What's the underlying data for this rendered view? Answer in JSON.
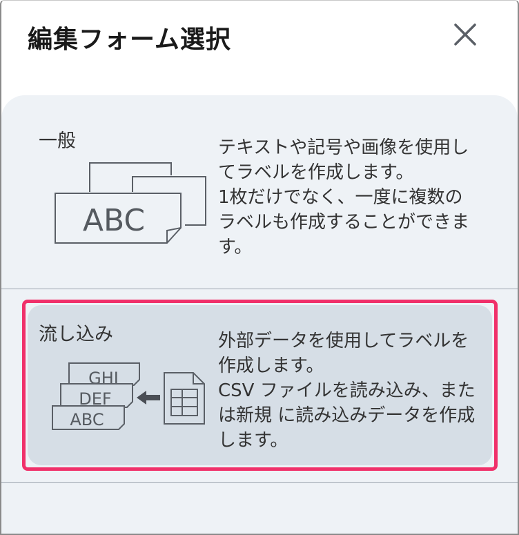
{
  "dialog": {
    "title": "編集フォーム選択"
  },
  "options": [
    {
      "label": "一般",
      "illustration_text": "ABC",
      "description": "テキストや記号や画像を使用し\nてラベルを作成します。\n1枚だけでなく、一度に複数の\nラベルも作成することができま\nす。"
    },
    {
      "label": "流し込み",
      "illustration_labels": [
        "GHI",
        "DEF",
        "ABC"
      ],
      "description": "外部データを使用してラベルを\n作成します。\nCSV ファイルを読み込み、また\nは新規 に読み込みデータを作成\nします。",
      "highlighted": true
    }
  ],
  "colors": {
    "highlight_border": "#f0306a",
    "panel_bg": "#eef2f6",
    "selected_bg": "#d6dee6",
    "icon_stroke": "#5a5f66"
  }
}
